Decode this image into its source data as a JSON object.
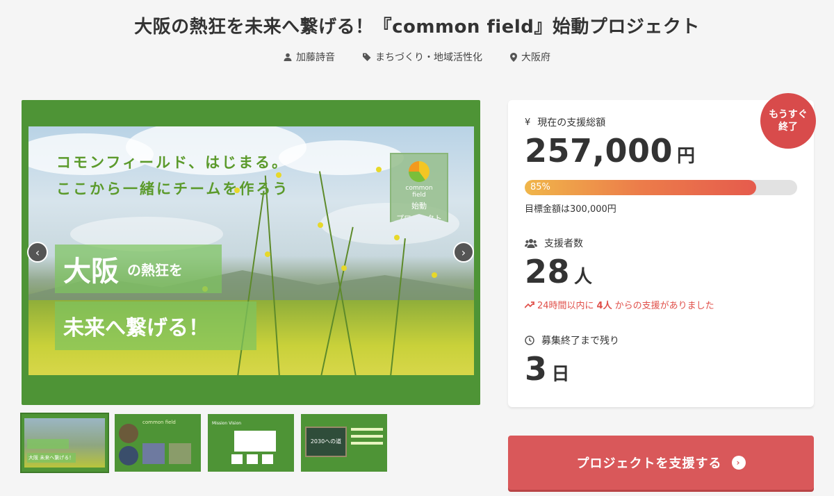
{
  "project": {
    "title": "大阪の熱狂を未来へ繋げる！『common field』始動プロジェクト",
    "author": "加藤詩音",
    "category": "まちづくり・地域活性化",
    "location": "大阪府"
  },
  "hero": {
    "tagline_1": "コモンフィールド、はじまる。",
    "tagline_2": "ここから一緒にチームを作ろう",
    "badge_line1": "common",
    "badge_line2": "field",
    "badge_line3": "始動",
    "badge_line4": "プロジェクト",
    "headline_big": "大阪",
    "headline_small": "の熱狂を",
    "headline_2": "未来へ繋げる！",
    "prev_arrow": "‹",
    "next_arrow": "›"
  },
  "thumbnails": [
    {
      "label": "大阪 未来へ繋げる！"
    },
    {
      "label": "common field"
    },
    {
      "label": "Mission Vision"
    },
    {
      "label": "2030への道"
    }
  ],
  "funding": {
    "amount_label": "現在の支援総額",
    "amount": "257,000",
    "amount_unit": "円",
    "progress_percent": 85,
    "progress_label": "85%",
    "goal_text": "目標金額は300,000円",
    "supporters_label": "支援者数",
    "supporters": "28",
    "supporters_unit": "人",
    "trend_pre": "24時間以内に",
    "trend_count": "4人",
    "trend_post": "からの支援がありました",
    "remaining_label": "募集終了まで残り",
    "remaining": "3",
    "remaining_unit": "日",
    "ending_badge_1": "もうすぐ",
    "ending_badge_2": "終了"
  },
  "cta": {
    "support_label": "プロジェクトを支援する",
    "arrow": "›"
  },
  "colors": {
    "accent_red": "#d9585a",
    "hero_green": "#4e9436"
  }
}
